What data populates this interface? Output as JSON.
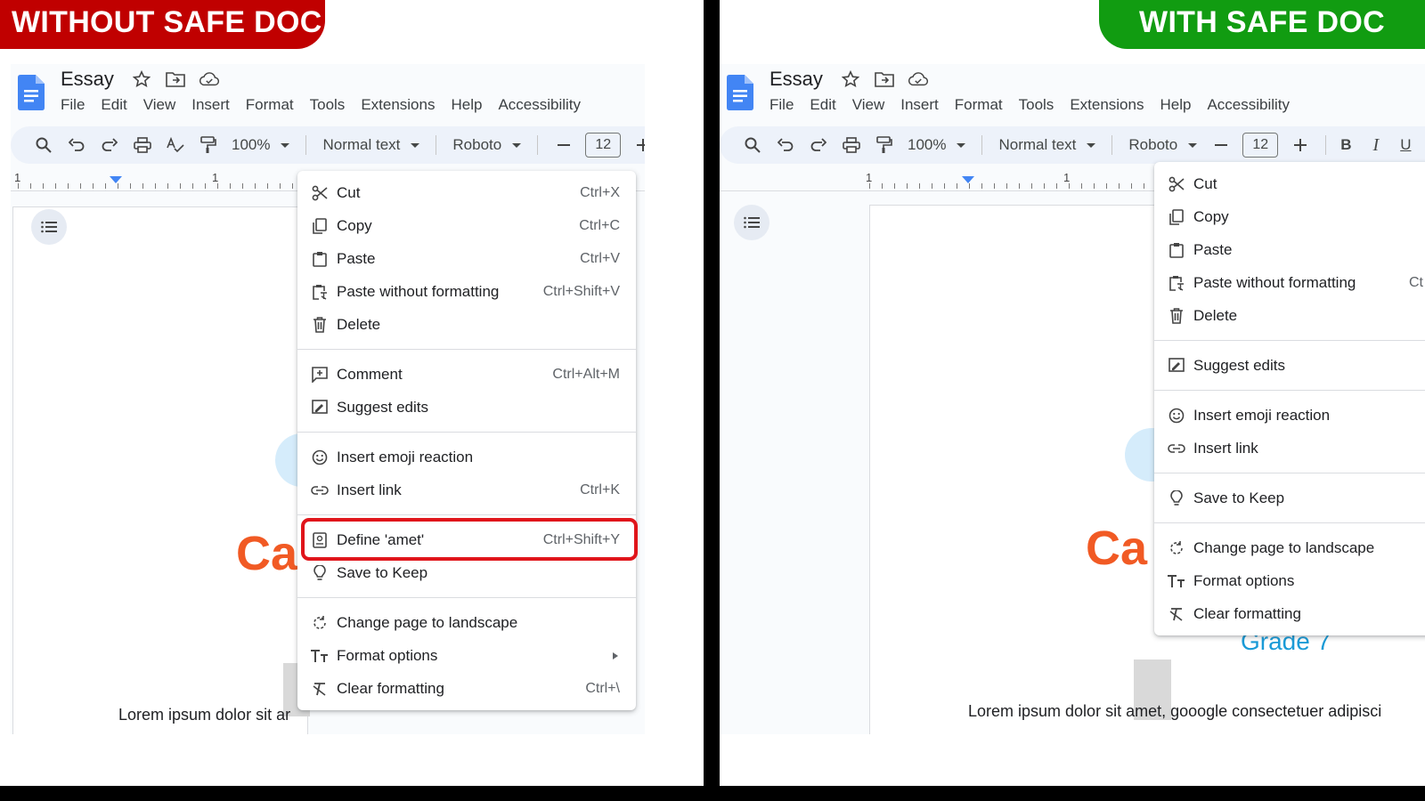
{
  "left": {
    "banner": "WITHOUT SAFE DOC",
    "doc_title": "Essay",
    "menu": [
      "File",
      "Edit",
      "View",
      "Insert",
      "Format",
      "Tools",
      "Extensions",
      "Help",
      "Accessibility"
    ],
    "toolbar": {
      "zoom": "100%",
      "style": "Normal text",
      "font": "Roboto",
      "font_size": "12"
    },
    "ruler": [
      "1",
      "1"
    ],
    "page_word": "Ca",
    "page_text": "Lorem ipsum dolor sit ar",
    "context_menu": [
      {
        "icon": "scissors-icon",
        "label": "Cut",
        "shortcut": "Ctrl+X"
      },
      {
        "icon": "copy-icon",
        "label": "Copy",
        "shortcut": "Ctrl+C"
      },
      {
        "icon": "clipboard-icon",
        "label": "Paste",
        "shortcut": "Ctrl+V"
      },
      {
        "icon": "paste-plain-icon",
        "label": "Paste without formatting",
        "shortcut": "Ctrl+Shift+V"
      },
      {
        "icon": "trash-icon",
        "label": "Delete",
        "shortcut": ""
      },
      {
        "sep": true
      },
      {
        "icon": "comment-add-icon",
        "label": "Comment",
        "shortcut": "Ctrl+Alt+M"
      },
      {
        "icon": "suggest-edit-icon",
        "label": "Suggest edits",
        "shortcut": ""
      },
      {
        "sep": true
      },
      {
        "icon": "emoji-icon",
        "label": "Insert emoji reaction",
        "shortcut": ""
      },
      {
        "icon": "link-icon",
        "label": "Insert link",
        "shortcut": "Ctrl+K"
      },
      {
        "sep": true
      },
      {
        "icon": "dictionary-icon",
        "label": "Define 'amet'",
        "shortcut": "Ctrl+Shift+Y",
        "highlight": true
      },
      {
        "icon": "lightbulb-icon",
        "label": "Save to Keep",
        "shortcut": ""
      },
      {
        "sep": true
      },
      {
        "icon": "rotate-page-icon",
        "label": "Change page to landscape",
        "shortcut": ""
      },
      {
        "icon": "text-format-icon",
        "label": "Format options",
        "shortcut": "",
        "submenu": true
      },
      {
        "icon": "clear-format-icon",
        "label": "Clear formatting",
        "shortcut": "Ctrl+\\"
      }
    ]
  },
  "right": {
    "banner": "WITH SAFE DOC",
    "doc_title": "Essay",
    "menu": [
      "File",
      "Edit",
      "View",
      "Insert",
      "Format",
      "Tools",
      "Extensions",
      "Help",
      "Accessibility"
    ],
    "toolbar": {
      "zoom": "100%",
      "style": "Normal text",
      "font": "Roboto",
      "font_size": "12",
      "bold": "B",
      "italic": "I",
      "underline": "U"
    },
    "ruler": [
      "1",
      "1"
    ],
    "page_word": "Ca",
    "page_grade": "Grade 7",
    "page_text": "Lorem ipsum dolor sit amet, gooogle consectetuer adipisci",
    "context_menu": [
      {
        "icon": "scissors-icon",
        "label": "Cut",
        "shortcut": ""
      },
      {
        "icon": "copy-icon",
        "label": "Copy",
        "shortcut": ""
      },
      {
        "icon": "clipboard-icon",
        "label": "Paste",
        "shortcut": ""
      },
      {
        "icon": "paste-plain-icon",
        "label": "Paste without formatting",
        "shortcut": "Ct"
      },
      {
        "icon": "trash-icon",
        "label": "Delete",
        "shortcut": ""
      },
      {
        "sep": true
      },
      {
        "icon": "suggest-edit-icon",
        "label": "Suggest edits",
        "shortcut": ""
      },
      {
        "sep": true
      },
      {
        "icon": "emoji-icon",
        "label": "Insert emoji reaction",
        "shortcut": ""
      },
      {
        "icon": "link-icon",
        "label": "Insert link",
        "shortcut": ""
      },
      {
        "sep": true
      },
      {
        "icon": "lightbulb-icon",
        "label": "Save to Keep",
        "shortcut": ""
      },
      {
        "sep": true
      },
      {
        "icon": "rotate-page-icon",
        "label": "Change page to landscape",
        "shortcut": ""
      },
      {
        "icon": "text-format-icon",
        "label": "Format options",
        "shortcut": ""
      },
      {
        "icon": "clear-format-icon",
        "label": "Clear formatting",
        "shortcut": ""
      }
    ]
  }
}
